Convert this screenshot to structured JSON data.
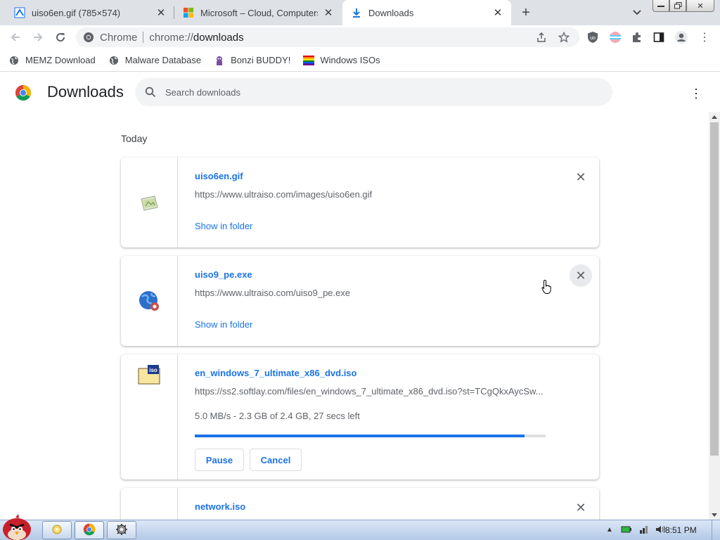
{
  "tabs": [
    {
      "title": "uiso6en.gif (785×574)",
      "icon": "image-icon"
    },
    {
      "title": "Microsoft – Cloud, Computers",
      "icon": "microsoft-icon"
    },
    {
      "title": "Downloads",
      "icon": "download-icon"
    }
  ],
  "omnibox": {
    "chip": "Chrome",
    "url_scheme": "chrome://",
    "url_host": "downloads"
  },
  "bookmarks": [
    {
      "label": "MEMZ Download",
      "icon": "globe-icon"
    },
    {
      "label": "Malware Database",
      "icon": "globe-icon"
    },
    {
      "label": "Bonzi BUDDY!",
      "icon": "bonzi-icon"
    },
    {
      "label": "Windows ISOs",
      "icon": "windows-flag-icon"
    }
  ],
  "downloads_page": {
    "title": "Downloads",
    "search_placeholder": "Search downloads",
    "section_label": "Today",
    "items": [
      {
        "filename": "uiso6en.gif",
        "url": "https://www.ultraiso.com/images/uiso6en.gif",
        "action": "Show in folder",
        "icon": "gif-file-icon"
      },
      {
        "filename": "uiso9_pe.exe",
        "url": "https://www.ultraiso.com/uiso9_pe.exe",
        "action": "Show in folder",
        "icon": "exe-file-icon"
      },
      {
        "filename": "en_windows_7_ultimate_x86_dvd.iso",
        "url": "https://ss2.softlay.com/files/en_windows_7_ultimate_x86_dvd.iso?st=TCgQkxAycSw...",
        "status": "5.0 MB/s - 2.3 GB of 2.4 GB, 27 secs left",
        "progress": 0.94,
        "pause_label": "Pause",
        "cancel_label": "Cancel",
        "icon": "iso-file-icon"
      },
      {
        "filename": "network.iso",
        "icon": "iso-file-icon"
      }
    ]
  },
  "taskbar": {
    "clock": "8:51 PM",
    "items": [
      "explorer",
      "chrome",
      "settings"
    ]
  },
  "colors": {
    "accent": "#1a73e8",
    "tabstrip": "#dee1e6"
  }
}
